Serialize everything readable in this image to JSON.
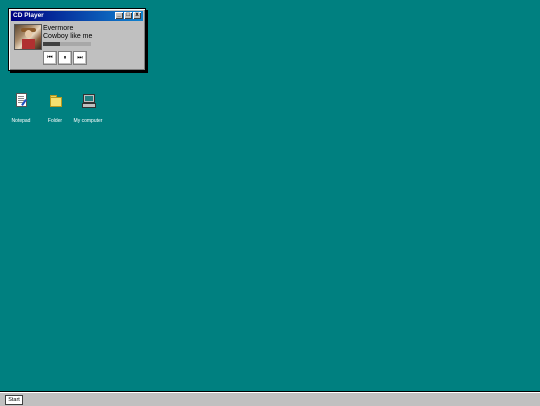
{
  "window": {
    "title": "CD Player",
    "minimize_glyph": "_",
    "maximize_glyph": "□",
    "close_glyph": "x"
  },
  "player": {
    "album": "Evermore",
    "song": "Cowboy like me",
    "progress_fraction": 0.36,
    "prev_glyph": "⏮",
    "pause_glyph": "⏸",
    "next_glyph": "⏭"
  },
  "desktop": {
    "icons": [
      {
        "label": "Notepad",
        "icon": "notepad-icon"
      },
      {
        "label": "Folder",
        "icon": "folder-icon"
      },
      {
        "label": "My computer",
        "icon": "computer-icon"
      }
    ]
  },
  "taskbar": {
    "start_label": "Start"
  },
  "colors": {
    "desktop": "#008080",
    "titlebar_start": "#000080",
    "titlebar_end": "#1084d0",
    "chrome": "#c0c0c0"
  }
}
